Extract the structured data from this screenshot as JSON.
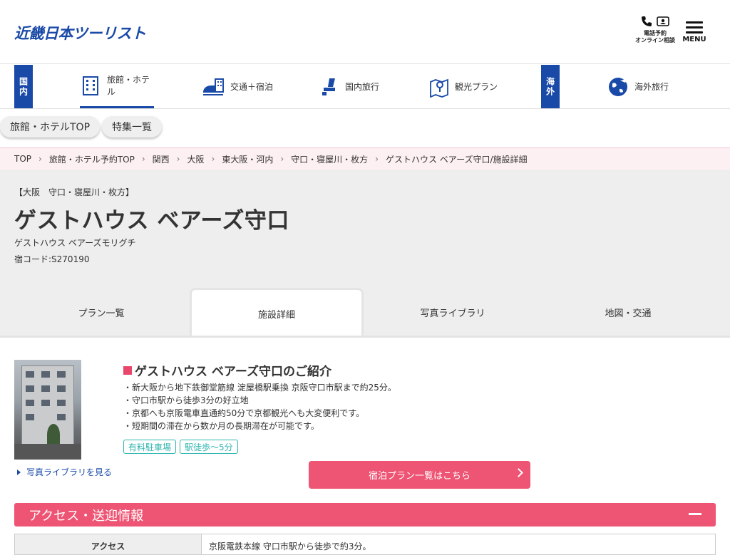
{
  "header": {
    "logo": "近畿日本ツーリスト",
    "phone_label_1": "電話予約",
    "phone_label_2": "オンライン相談",
    "menu_label": "MENU"
  },
  "catnav": {
    "domestic_tag": "国内",
    "overseas_tag": "海外",
    "items": [
      {
        "label": "旅館・ホテル",
        "icon": "building-icon"
      },
      {
        "label": "交通＋宿泊",
        "icon": "train-hotel-icon"
      },
      {
        "label": "国内旅行",
        "icon": "seat-icon"
      },
      {
        "label": "観光プラン",
        "icon": "map-pin-icon"
      },
      {
        "label": "海外旅行",
        "icon": "globe-plane-icon"
      }
    ]
  },
  "subnav": {
    "items": [
      "旅館・ホテルTOP",
      "特集一覧"
    ]
  },
  "breadcrumb": [
    "TOP",
    "旅館・ホテル予約TOP",
    "関西",
    "大阪",
    "東大阪・河内",
    "守口・寝屋川・枚方",
    "ゲストハウス ベアーズ守口/施設詳細"
  ],
  "hotel": {
    "area": "【大阪　守口・寝屋川・枚方】",
    "name": "ゲストハウス ベアーズ守口",
    "kana": "ゲストハウス ベアーズモリグチ",
    "code": "宿コード:S270190"
  },
  "tabs": [
    "プラン一覧",
    "施設詳細",
    "写真ライブラリ",
    "地図・交通"
  ],
  "intro": {
    "title": "ゲストハウス ベアーズ守口のご紹介",
    "bullets": [
      "・新大阪から地下鉄御堂筋線 淀屋橋駅乗換 京阪守口市駅まで約25分。",
      "・守口市駅から徒歩3分の好立地",
      "・京都へも京阪電車直通約50分で京都観光へも大変便利です。",
      "・短期間の滞在から数か月の長期滞在が可能です。"
    ],
    "chips": [
      "有料駐車場",
      "駅徒歩～5分"
    ],
    "photo_link": "写真ライブラリを見る",
    "plan_button": "宿泊プラン一覧はこちら"
  },
  "access": {
    "title": "アクセス・送迎情報",
    "row_label": "アクセス",
    "row_value": "京阪電鉄本線 守口市駅から徒歩で約3分。"
  },
  "colors": {
    "brand_blue": "#1a4aa8",
    "accent_pink": "#ee5473",
    "chip_teal": "#2fb5b0"
  }
}
